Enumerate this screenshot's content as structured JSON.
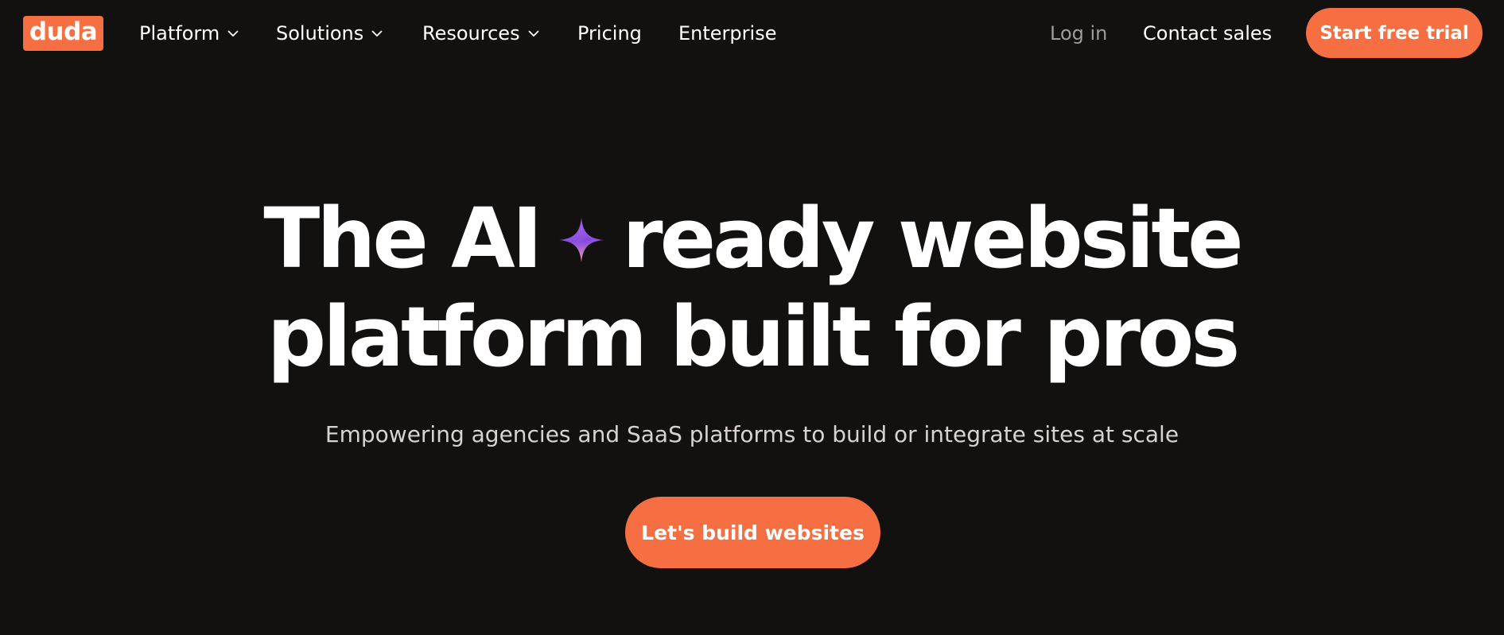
{
  "header": {
    "logo_text": "duda",
    "nav": [
      {
        "label": "Platform",
        "has_dropdown": true,
        "icon": "chevron-down-icon"
      },
      {
        "label": "Solutions",
        "has_dropdown": true,
        "icon": "chevron-down-icon"
      },
      {
        "label": "Resources",
        "has_dropdown": true,
        "icon": "chevron-down-icon"
      },
      {
        "label": "Pricing",
        "has_dropdown": false
      },
      {
        "label": "Enterprise",
        "has_dropdown": false
      }
    ],
    "login_label": "Log in",
    "contact_label": "Contact sales",
    "trial_label": "Start free trial"
  },
  "hero": {
    "title_line1_a": "The AI",
    "title_line1_b": "ready website",
    "title_line2": "platform built for pros",
    "sparkle_icon": "sparkle-icon",
    "subtitle": "Empowering agencies and SaaS platforms to build or integrate sites at scale",
    "cta_label": "Let's build websites"
  },
  "colors": {
    "background": "#131010",
    "accent": "#f56f42",
    "text_primary": "#ffffff",
    "text_muted": "#a09c9a",
    "subtitle": "#d8d3d0",
    "sparkle_top": "#a35cf0",
    "sparkle_bottom": "#f0a0a8"
  }
}
